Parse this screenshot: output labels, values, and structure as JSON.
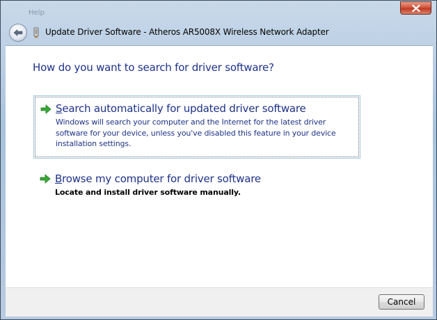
{
  "window": {
    "title": "Update Driver Software - Atheros AR5008X Wireless Network Adapter",
    "background_ghost_text": [
      "Help"
    ]
  },
  "content": {
    "heading": "How do you want to search for driver software?",
    "options": [
      {
        "title_first": "S",
        "title_rest": "earch automatically for updated driver software",
        "description": "Windows will search your computer and the Internet for the latest driver software for your device, unless you've disabled this feature in your device installation settings.",
        "focused": true,
        "icon": "green-arrow-icon"
      },
      {
        "title_first": "B",
        "title_rest": "rowse my computer for driver software",
        "description": "Locate and install driver software manually.",
        "focused": false,
        "icon": "green-arrow-icon"
      }
    ]
  },
  "footer": {
    "cancel_label": "Cancel"
  },
  "colors": {
    "link_blue": "#1e3287",
    "arrow_green": "#3aa83a",
    "close_red": "#c13a22"
  }
}
